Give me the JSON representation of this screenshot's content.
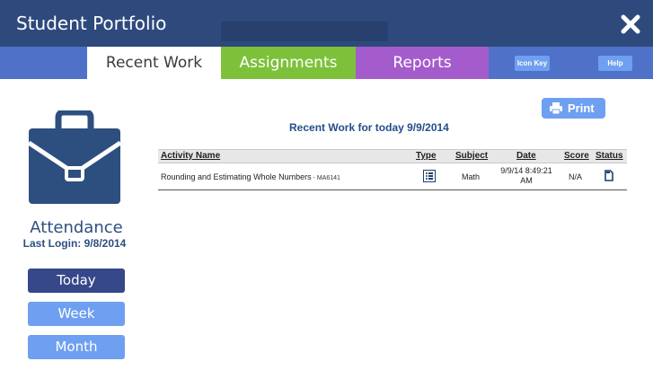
{
  "window": {
    "title": "Student Portfolio",
    "close_icon": "close-x-icon"
  },
  "tabs": [
    {
      "label": "Recent Work",
      "color": "#ffffff",
      "selected": true
    },
    {
      "label": "Assignments",
      "color": "#7dc13a",
      "selected": false
    },
    {
      "label": "Reports",
      "color": "#a45ccc",
      "selected": false
    }
  ],
  "toolbar": {
    "icon_key_label": "Icon Key",
    "help_label": "Help"
  },
  "sidebar": {
    "icon": "briefcase-icon",
    "attendance_label": "Attendance",
    "last_login": "Last Login: 9/8/2014",
    "buttons": [
      {
        "label": "Today",
        "selected": true
      },
      {
        "label": "Week",
        "selected": false
      },
      {
        "label": "Month",
        "selected": false
      }
    ]
  },
  "main": {
    "print_label": "Print",
    "heading": "Recent Work for today 9/9/2014",
    "columns": [
      "Activity Name",
      "Type",
      "Subject",
      "Date",
      "Score",
      "Status"
    ],
    "rows": [
      {
        "activity": "Rounding and Estimating Whole Numbers",
        "code": " - MA6141",
        "type_icon": "worksheet-icon",
        "subject": "Math",
        "date_line1": "9/9/14 8:49:21",
        "date_line2": "AM",
        "score": "N/A",
        "status_icon": "document-icon"
      }
    ]
  },
  "colors": {
    "header_bg": "#2e4a7d",
    "tabbar_bg": "#4f72c8",
    "button_blue": "#6f9ff0",
    "selected_button": "#36478a",
    "heading_text": "#234e8a"
  }
}
